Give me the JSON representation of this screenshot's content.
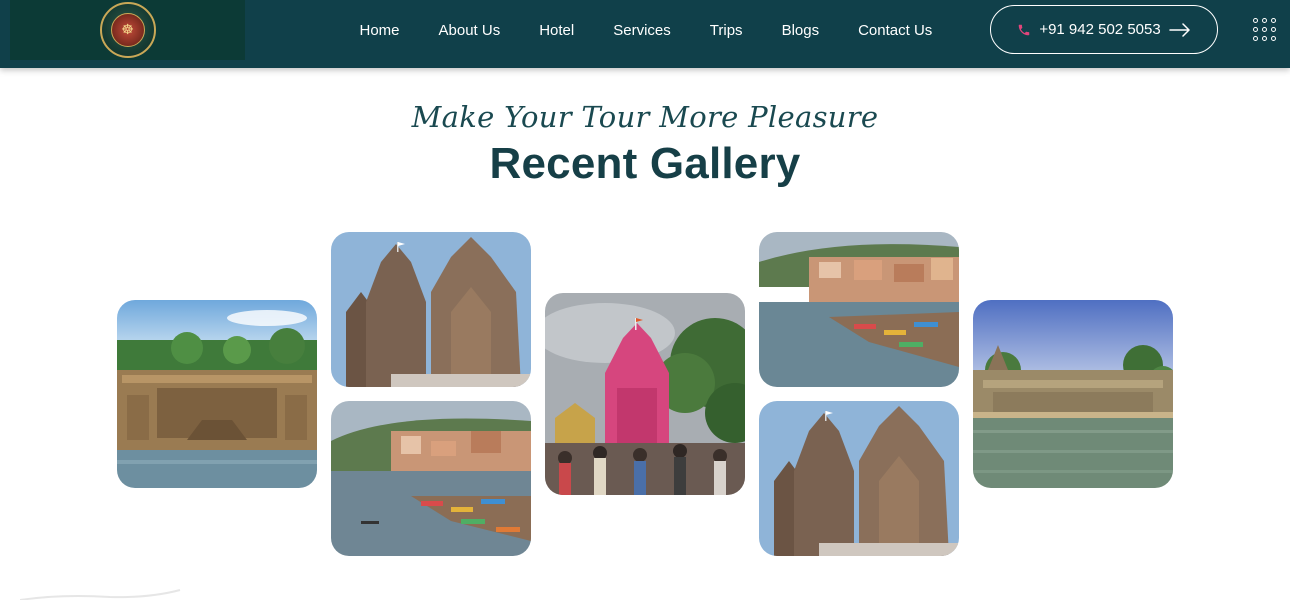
{
  "brand": {
    "logo_icon": "temple-emblem-logo"
  },
  "nav": {
    "items": [
      {
        "label": "Home"
      },
      {
        "label": "About Us"
      },
      {
        "label": "Hotel"
      },
      {
        "label": "Services"
      },
      {
        "label": "Trips"
      },
      {
        "label": "Blogs"
      },
      {
        "label": "Contact Us"
      }
    ],
    "phone": "+91 942 502 5053",
    "phone_icon": "phone-icon",
    "arrow_icon": "arrow-right-icon",
    "menu_icon": "grid-menu-icon"
  },
  "section": {
    "subtitle": "Make Your Tour More Pleasure",
    "title": "Recent Gallery"
  },
  "gallery": {
    "images": [
      {
        "name": "fort-riverfront-photo"
      },
      {
        "name": "stone-temples-photo"
      },
      {
        "name": "river-ghats-boats-photo"
      },
      {
        "name": "pink-temple-crowd-photo"
      },
      {
        "name": "river-ghats-town-photo"
      },
      {
        "name": "stone-temples-photo-2"
      },
      {
        "name": "temple-riverbank-photo"
      }
    ]
  },
  "colors": {
    "navbar": "#10404a",
    "title": "#163f47",
    "phone_icon": "#e0457b"
  }
}
